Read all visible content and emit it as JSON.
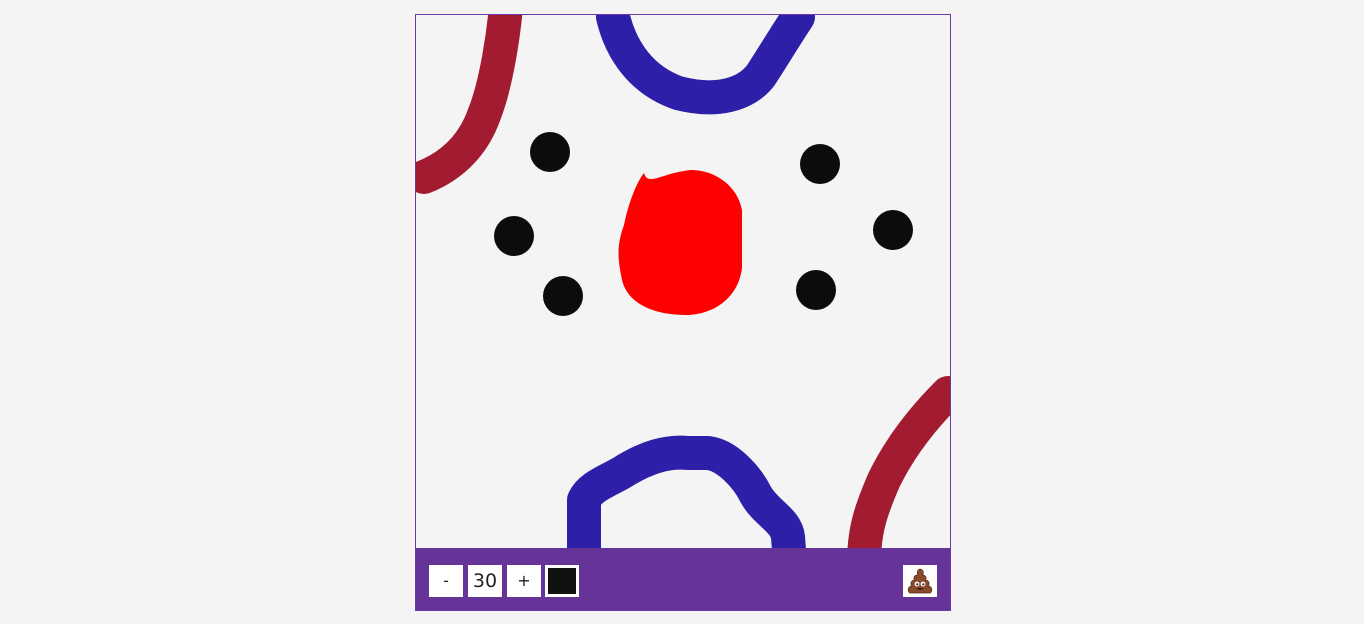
{
  "canvas": {
    "background": "#f4f4f4"
  },
  "toolbar": {
    "background": "#663399",
    "decrease_label": "-",
    "brush_size": "30",
    "increase_label": "+",
    "current_color": "#111111",
    "clear_icon": "poop-emoji-icon"
  },
  "colors": {
    "dark_red": "#a31b31",
    "blue": "#2d1fa8",
    "red": "#ff0000",
    "black": "#0c0c0c",
    "border": "#6d3aa8"
  }
}
